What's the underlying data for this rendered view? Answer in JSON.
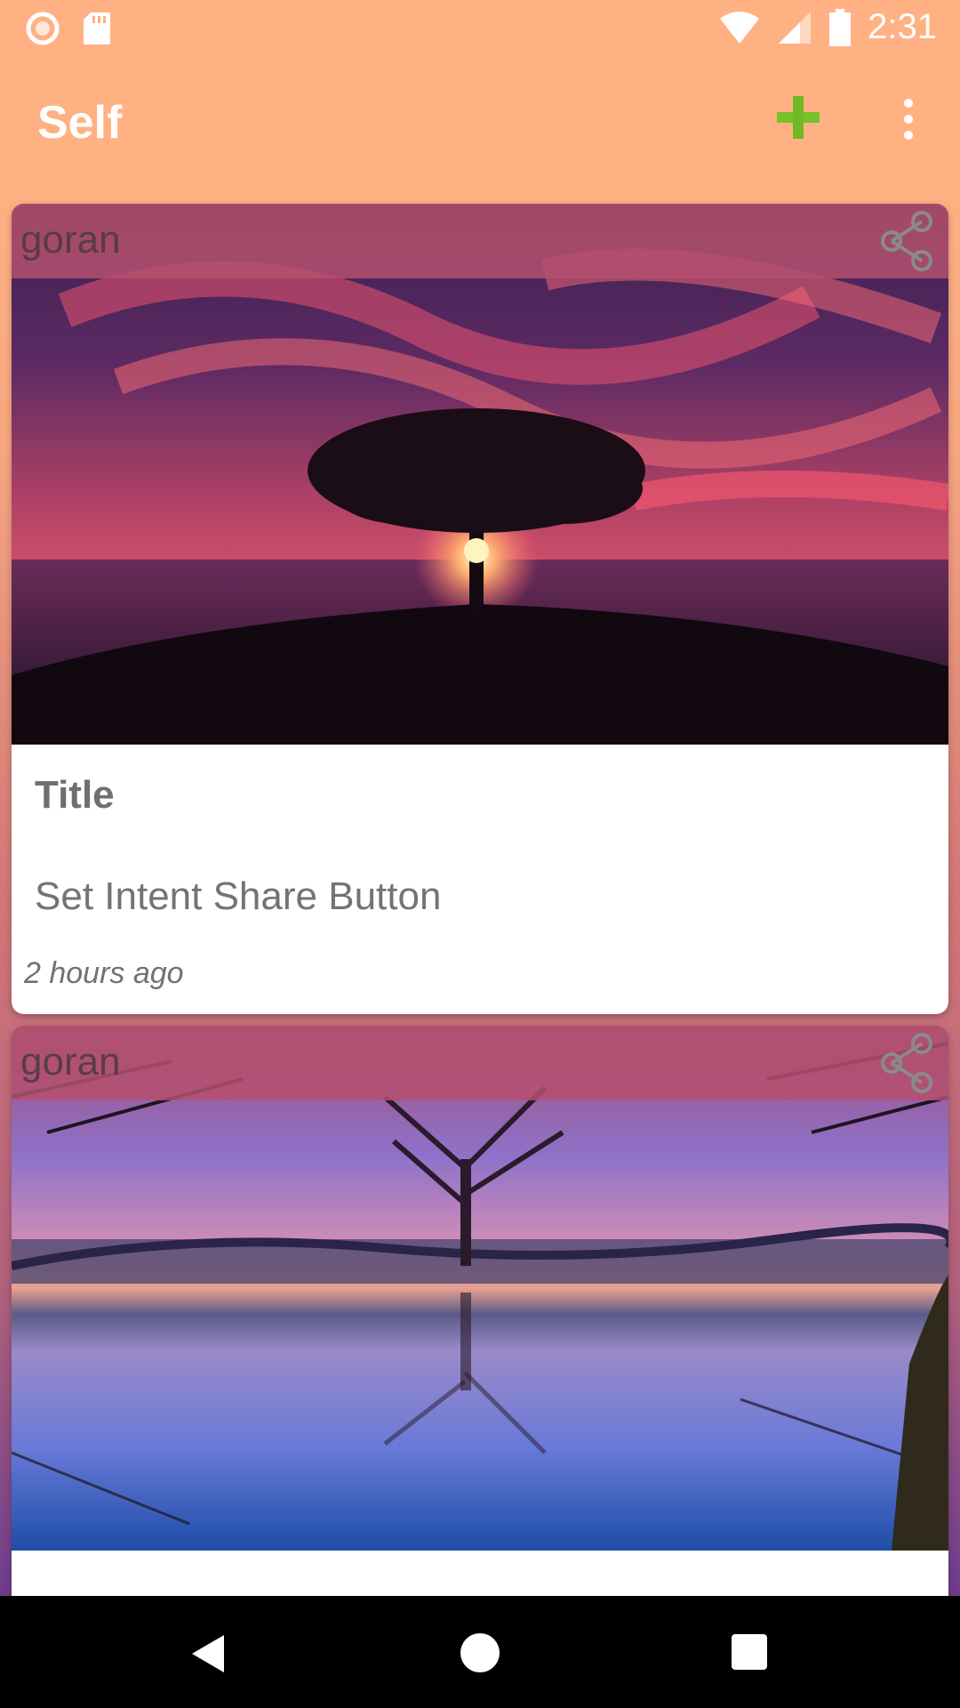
{
  "status_bar": {
    "time": "2:31",
    "icons": [
      "circle-notification-icon",
      "sd-card-icon",
      "wifi-icon",
      "signal-icon",
      "battery-icon"
    ]
  },
  "app_bar": {
    "title": "Self",
    "actions": [
      "add-icon",
      "more-vert-icon"
    ],
    "accent_color": "#77c22a"
  },
  "posts": [
    {
      "author": "goran",
      "title": "Title",
      "description": "Set Intent Share Button",
      "time": "2 hours ago",
      "image": "sunset-tree-on-hill"
    },
    {
      "author": "goran",
      "title": "",
      "description": "",
      "time": "",
      "image": "lake-trees-reflection"
    }
  ],
  "nav_bar": {
    "icons": [
      "back-icon",
      "home-icon",
      "recents-icon"
    ]
  }
}
